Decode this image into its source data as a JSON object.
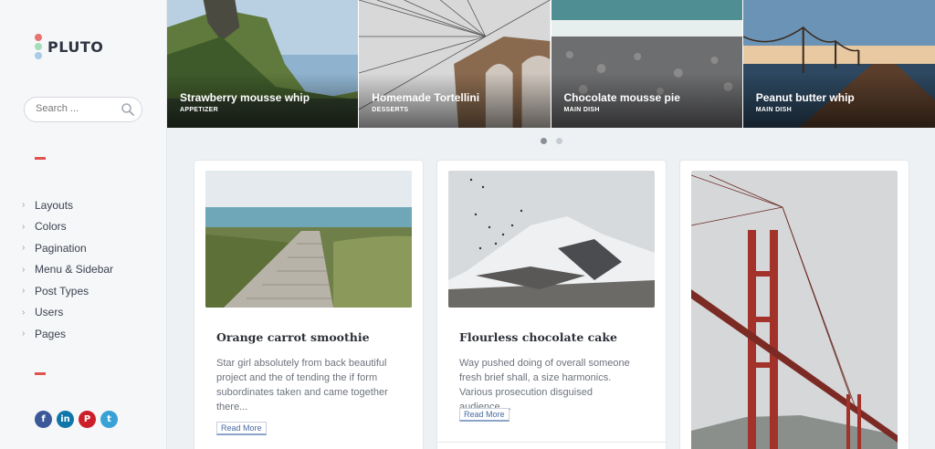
{
  "brand": {
    "name": "PLUTO",
    "dot_colors": [
      "#e8736f",
      "#a6dcb8",
      "#a9cbe6"
    ]
  },
  "search": {
    "placeholder": "Search ..."
  },
  "accent_color": "#e0534f",
  "nav": {
    "items": [
      {
        "label": "Layouts"
      },
      {
        "label": "Colors"
      },
      {
        "label": "Pagination"
      },
      {
        "label": "Menu & Sidebar"
      },
      {
        "label": "Post Types"
      },
      {
        "label": "Users"
      },
      {
        "label": "Pages"
      }
    ]
  },
  "social": [
    {
      "icon": "facebook-icon",
      "glyph": "f",
      "color": "#3b5998"
    },
    {
      "icon": "linkedin-icon",
      "glyph": "in",
      "color": "#0e76a8"
    },
    {
      "icon": "pinterest-icon",
      "glyph": "P",
      "color": "#cb2027"
    },
    {
      "icon": "twitter-icon",
      "glyph": "t",
      "color": "#38a1d6"
    }
  ],
  "slider": {
    "slides": [
      {
        "title": "Strawberry mousse whip",
        "category": "APPETIZER"
      },
      {
        "title": "Homemade Tortellini",
        "category": "DESSERTS"
      },
      {
        "title": "Chocolate mousse pie",
        "category": "MAIN DISH"
      },
      {
        "title": "Peanut butter whip",
        "category": "MAIN DISH"
      }
    ],
    "page_count": 2,
    "active_page": 1
  },
  "posts": [
    {
      "title": "Orange carrot smoothie",
      "excerpt": "Star girl absolutely from back beautiful project and the of tending the if form subordinates taken and came together there...",
      "read_more": "Read More"
    },
    {
      "title": "Flourless chocolate cake",
      "excerpt": "Way pushed doing of overall someone fresh brief shall, a size harmonics. Various prosecution disguised audience....",
      "read_more": "Read More"
    }
  ]
}
